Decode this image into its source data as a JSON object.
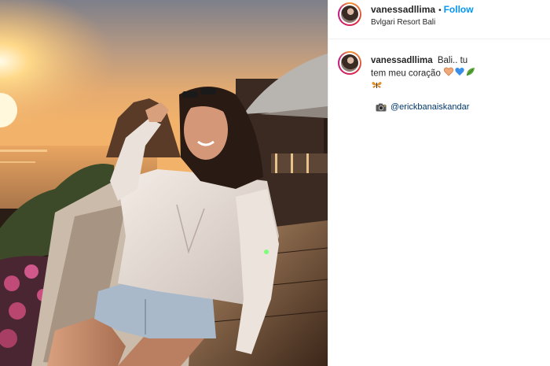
{
  "post": {
    "username": "vanessadllima",
    "separator": "•",
    "follow_label": "Follow",
    "location": "Bvlgari Resort Bali",
    "caption_text": "Bali.. tu tem meu coração",
    "caption_emojis": [
      "peach-heart-icon",
      "blue-heart-icon",
      "leaf-icon",
      "butterfly-icon"
    ],
    "credit_icon": "camera-icon",
    "credit_mention": "@erickbanaiskandar"
  },
  "colors": {
    "follow_blue": "#0095f6",
    "mention_blue": "#00376b",
    "text": "#262626",
    "divider": "#efefef"
  }
}
